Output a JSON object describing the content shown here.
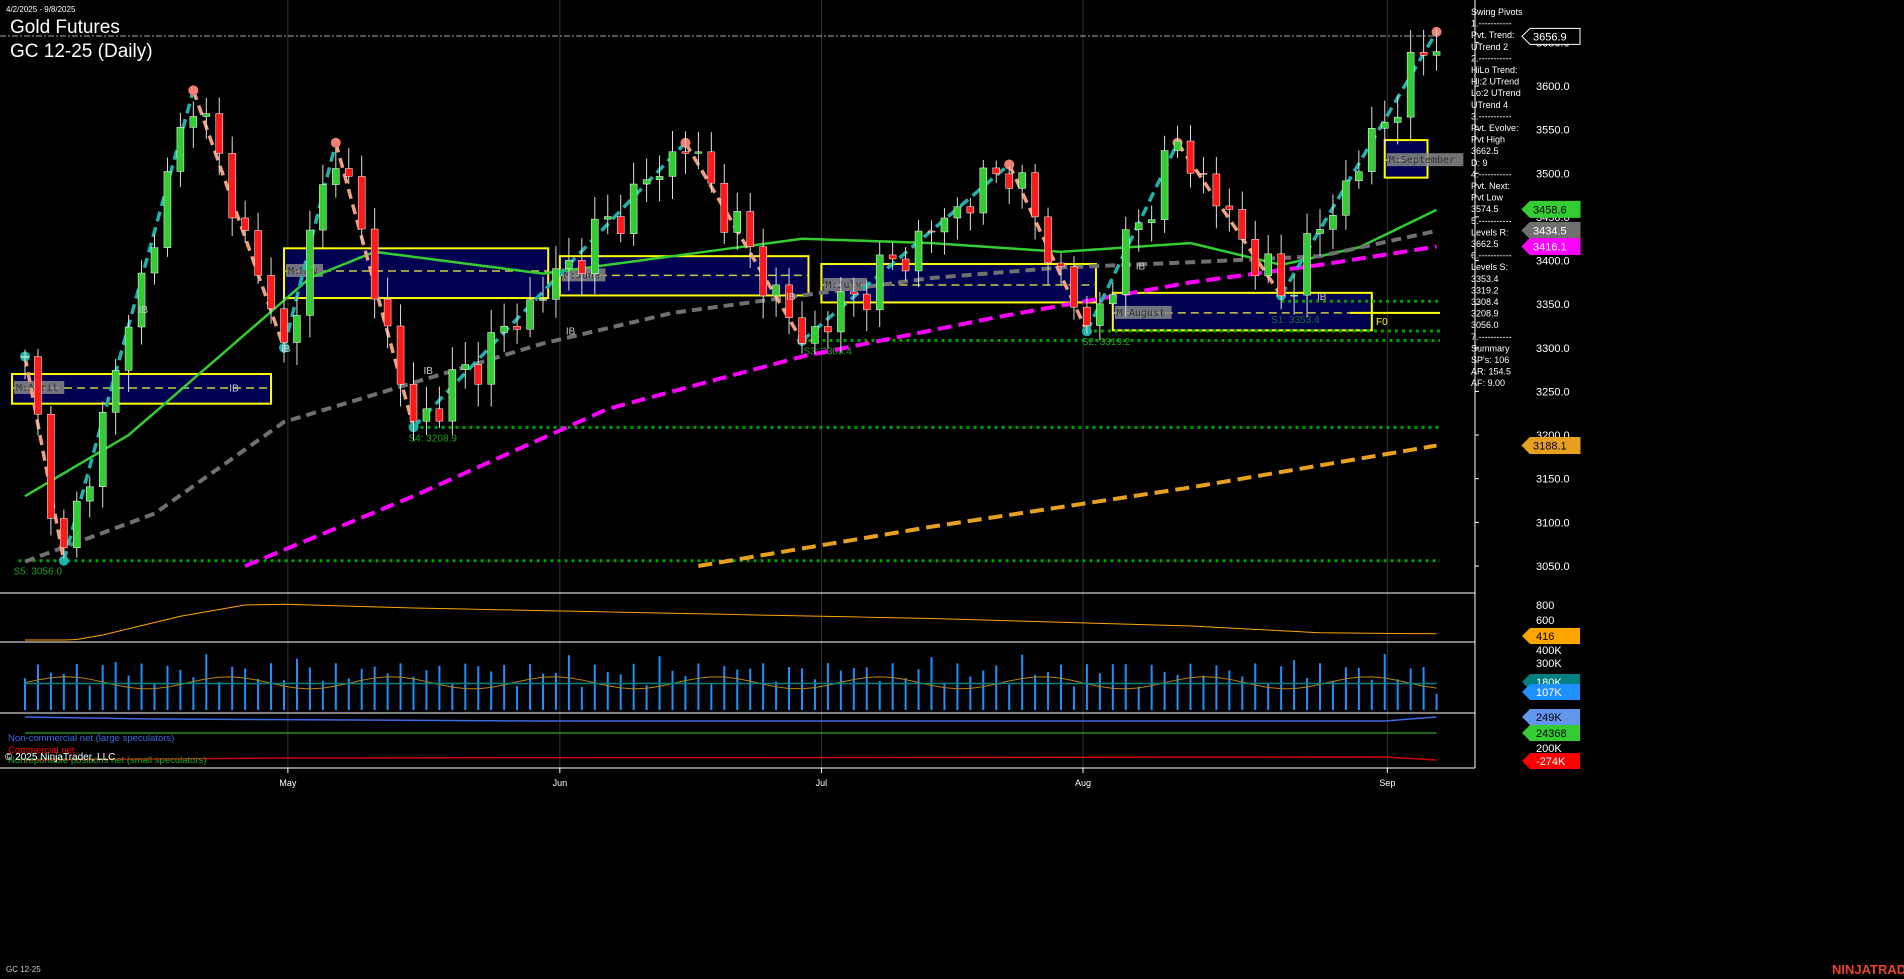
{
  "header": {
    "date_range": "4/2/2025 - 9/8/2025",
    "title": "Gold Futures",
    "subtitle": "GC 12-25 (Daily)"
  },
  "info_panel": {
    "lines": [
      "Swing Pivots",
      "1.-----------",
      "Pvt. Trend:",
      "UTrend 2",
      "2.-----------",
      "HiLo Trend:",
      "Hi:2 UTrend",
      "Lo:2 UTrend",
      "UTrend 4",
      "3.-----------",
      "Pvt. Evolve:",
      "Pvt High",
      "3662.5",
      "D: 9",
      "4.-----------",
      "Pvt. Next:",
      "Pvt Low",
      "3574.5",
      "5.-----------",
      "Levels R:",
      "3662.5",
      "6.-----------",
      "Levels S:",
      "3353.4",
      "3319.2",
      "3308.4",
      "3208.9",
      "3056.0",
      "7.-----------",
      "Summary",
      "SP's: 106",
      "AR: 154.5",
      "AF: 9.00"
    ]
  },
  "price_axis": {
    "ticks": [
      "3650.0",
      "3600.0",
      "3550.0",
      "3500.0",
      "3450.0",
      "3400.0",
      "3350.0",
      "3300.0",
      "3250.0",
      "3200.0",
      "3150.0",
      "3100.0",
      "3050.0"
    ],
    "tags": [
      {
        "label": "3656.9",
        "price": 3656.9,
        "color": "#000000",
        "text": "#ffffff",
        "border": "#ffffff"
      },
      {
        "label": "3458.6",
        "price": 3458.6,
        "color": "#33cc33",
        "text": "#000000",
        "border": "#33cc33"
      },
      {
        "label": "3434.5",
        "price": 3434.5,
        "color": "#707070",
        "text": "#ffffff",
        "border": "#707070"
      },
      {
        "label": "3416.1",
        "price": 3416.1,
        "color": "#ff00ff",
        "text": "#ffffff",
        "border": "#ff00ff"
      },
      {
        "label": "3188.1",
        "price": 3188.1,
        "color": "#e8a020",
        "text": "#000000",
        "border": "#e8a020"
      }
    ]
  },
  "indicator_axis": {
    "ticks": [
      "800",
      "600"
    ],
    "tag": "416",
    "tag_color": "#ffa500"
  },
  "volume_axis": {
    "ticks": [
      "400K",
      "300K"
    ],
    "tag1": "180K",
    "tag1_color": "#008080",
    "tag2": "107K",
    "tag2_color": "#1e90ff"
  },
  "cot_axis": {
    "tag1": "249K",
    "tag1_color": "#6495ed",
    "tag2": "24368",
    "tag2_color": "#33cc33",
    "tag3": "-274K",
    "tag3_color": "#ff0000",
    "partial": "200K"
  },
  "cot_legend": {
    "noncommercial": "Non-commercial net (large speculators)",
    "commercial": "Commercial net",
    "nonreportable": "Nonreportable positions net (small speculators)"
  },
  "x_axis": {
    "months": [
      {
        "label": "May",
        "bar": 20.3
      },
      {
        "label": "Jun",
        "bar": 41.3
      },
      {
        "label": "Jul",
        "bar": 61.5
      },
      {
        "label": "Aug",
        "bar": 81.7
      },
      {
        "label": "Sep",
        "bar": 105.2
      }
    ]
  },
  "footer": {
    "copyright": "© 2025 NinjaTrader, LLC",
    "instrument": "GC 12-25",
    "brand": "NINJATRADER"
  },
  "monthly_boxes": [
    {
      "label": "M:April",
      "bar_start": -1,
      "bar_end": 19,
      "top": 3270,
      "bottom": 3236,
      "mid": 3254
    },
    {
      "label": "M:May",
      "bar_start": 20,
      "bar_end": 40.4,
      "top": 3414,
      "bottom": 3357,
      "mid": 3388
    },
    {
      "label": "M:June",
      "bar_start": 41.3,
      "bar_end": 60.5,
      "top": 3405,
      "bottom": 3360,
      "mid": 3383
    },
    {
      "label": "M:July",
      "bar_start": 61.5,
      "bar_end": 82.7,
      "top": 3396,
      "bottom": 3352,
      "mid": 3372
    },
    {
      "label": "M:August",
      "bar_start": 84,
      "bar_end": 104,
      "top": 3363,
      "bottom": 3320,
      "mid": 3340
    },
    {
      "label": "M:September",
      "bar_start": 105,
      "bar_end": 108.3,
      "top": 3538,
      "bottom": 3495,
      "mid": 3515
    }
  ],
  "support_levels": [
    {
      "label": "S5: 3056.0",
      "price": 3056.0,
      "from_bar": -0.5
    },
    {
      "label": "S4: 3208.9",
      "price": 3208.9,
      "from_bar": 30
    },
    {
      "label": "S3: 3308.4",
      "price": 3308.4,
      "from_bar": 60.5
    },
    {
      "label": "S2: 3319.2",
      "price": 3319.2,
      "from_bar": 82
    },
    {
      "label": "S1: 3353.4",
      "price": 3353.4,
      "from_bar": 97
    }
  ],
  "f0_label": "F0",
  "ib_label": "IB",
  "chart_data": {
    "type": "candlestick",
    "title": "GC 12-25 (Daily)",
    "date_range": [
      "4/2/2025",
      "9/8/2025"
    ],
    "ylim": [
      3000,
      3680
    ],
    "bars": 110,
    "swing_pivots": [
      [
        0,
        3290
      ],
      [
        3,
        3056
      ],
      [
        13,
        3595
      ],
      [
        20,
        3300
      ],
      [
        24,
        3535
      ],
      [
        30,
        3209
      ],
      [
        51,
        3535
      ],
      [
        60,
        3308
      ],
      [
        76,
        3510
      ],
      [
        82,
        3319
      ],
      [
        89,
        3535
      ],
      [
        97,
        3360
      ],
      [
        109,
        3662
      ]
    ],
    "moving_averages": [
      {
        "name": "green",
        "color": "#33cc33",
        "points": [
          [
            0,
            3130
          ],
          [
            8,
            3200
          ],
          [
            15,
            3290
          ],
          [
            22,
            3380
          ],
          [
            27,
            3410
          ],
          [
            40,
            3385
          ],
          [
            50,
            3405
          ],
          [
            60,
            3425
          ],
          [
            70,
            3420
          ],
          [
            80,
            3410
          ],
          [
            90,
            3420
          ],
          [
            97,
            3395
          ],
          [
            103,
            3415
          ],
          [
            109,
            3458
          ]
        ]
      },
      {
        "name": "gray",
        "color": "#707070",
        "points": [
          [
            0,
            3055
          ],
          [
            10,
            3110
          ],
          [
            20,
            3215
          ],
          [
            30,
            3260
          ],
          [
            40,
            3305
          ],
          [
            50,
            3340
          ],
          [
            60,
            3360
          ],
          [
            70,
            3380
          ],
          [
            80,
            3392
          ],
          [
            90,
            3398
          ],
          [
            100,
            3405
          ],
          [
            109,
            3434
          ]
        ]
      },
      {
        "name": "magenta",
        "color": "#ff00ff",
        "points": [
          [
            17,
            3050
          ],
          [
            30,
            3130
          ],
          [
            45,
            3230
          ],
          [
            60,
            3290
          ],
          [
            75,
            3335
          ],
          [
            90,
            3375
          ],
          [
            100,
            3395
          ],
          [
            109,
            3416
          ]
        ]
      },
      {
        "name": "orange",
        "color": "#e8a020",
        "points": [
          [
            52,
            3050
          ],
          [
            70,
            3095
          ],
          [
            90,
            3140
          ],
          [
            109,
            3188
          ]
        ]
      }
    ],
    "indicator": {
      "color": "#ffa500",
      "points": [
        [
          0,
          220
        ],
        [
          6,
          400
        ],
        [
          12,
          650
        ],
        [
          17,
          800
        ],
        [
          20,
          810
        ],
        [
          30,
          760
        ],
        [
          50,
          690
        ],
        [
          70,
          620
        ],
        [
          90,
          520
        ],
        [
          100,
          430
        ],
        [
          109,
          416
        ]
      ]
    },
    "volume": {
      "ylim": [
        0,
        450000
      ],
      "last_k": 107,
      "avg_k": 180
    },
    "cot": {
      "noncommercial_k": 249,
      "nonreportable": 24368,
      "commercial_k": -274
    }
  }
}
